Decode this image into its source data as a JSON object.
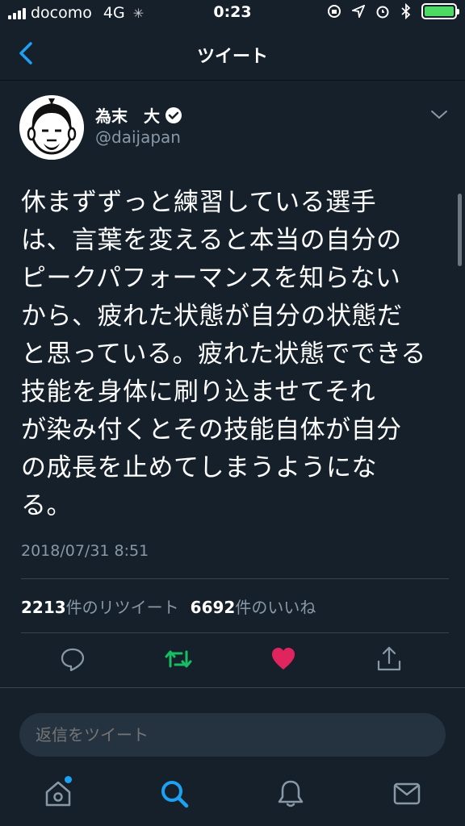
{
  "status_bar": {
    "carrier": "docomo",
    "network": "4G",
    "time": "0:23"
  },
  "nav": {
    "title": "ツイート"
  },
  "tweet": {
    "author_name": "為末　大",
    "author_handle": "@daijapan",
    "text_lines": [
      "休まずずっと練習している選手",
      "は、言葉を変えると本当の自分の",
      "ピークパフォーマンスを知らない",
      "から、疲れた状態が自分の状態だ",
      "と思っている。疲れた状態でできる",
      "技能を身体に刷り込ませてそれ",
      "が染み付くとその技能自体が自分",
      "の成長を止めてしまうようにな",
      "る。"
    ],
    "date": "2018/07/31 8:51",
    "retweet_count": "2213",
    "retweet_label": "件のリツイート",
    "like_count": "6692",
    "like_label": "件のいいね"
  },
  "reply": {
    "placeholder": "返信をツイート"
  },
  "colors": {
    "background": "#15202b",
    "accent": "#1da1f2",
    "retweet": "#17bf63",
    "like": "#e0245e",
    "muted": "#8899a6"
  }
}
